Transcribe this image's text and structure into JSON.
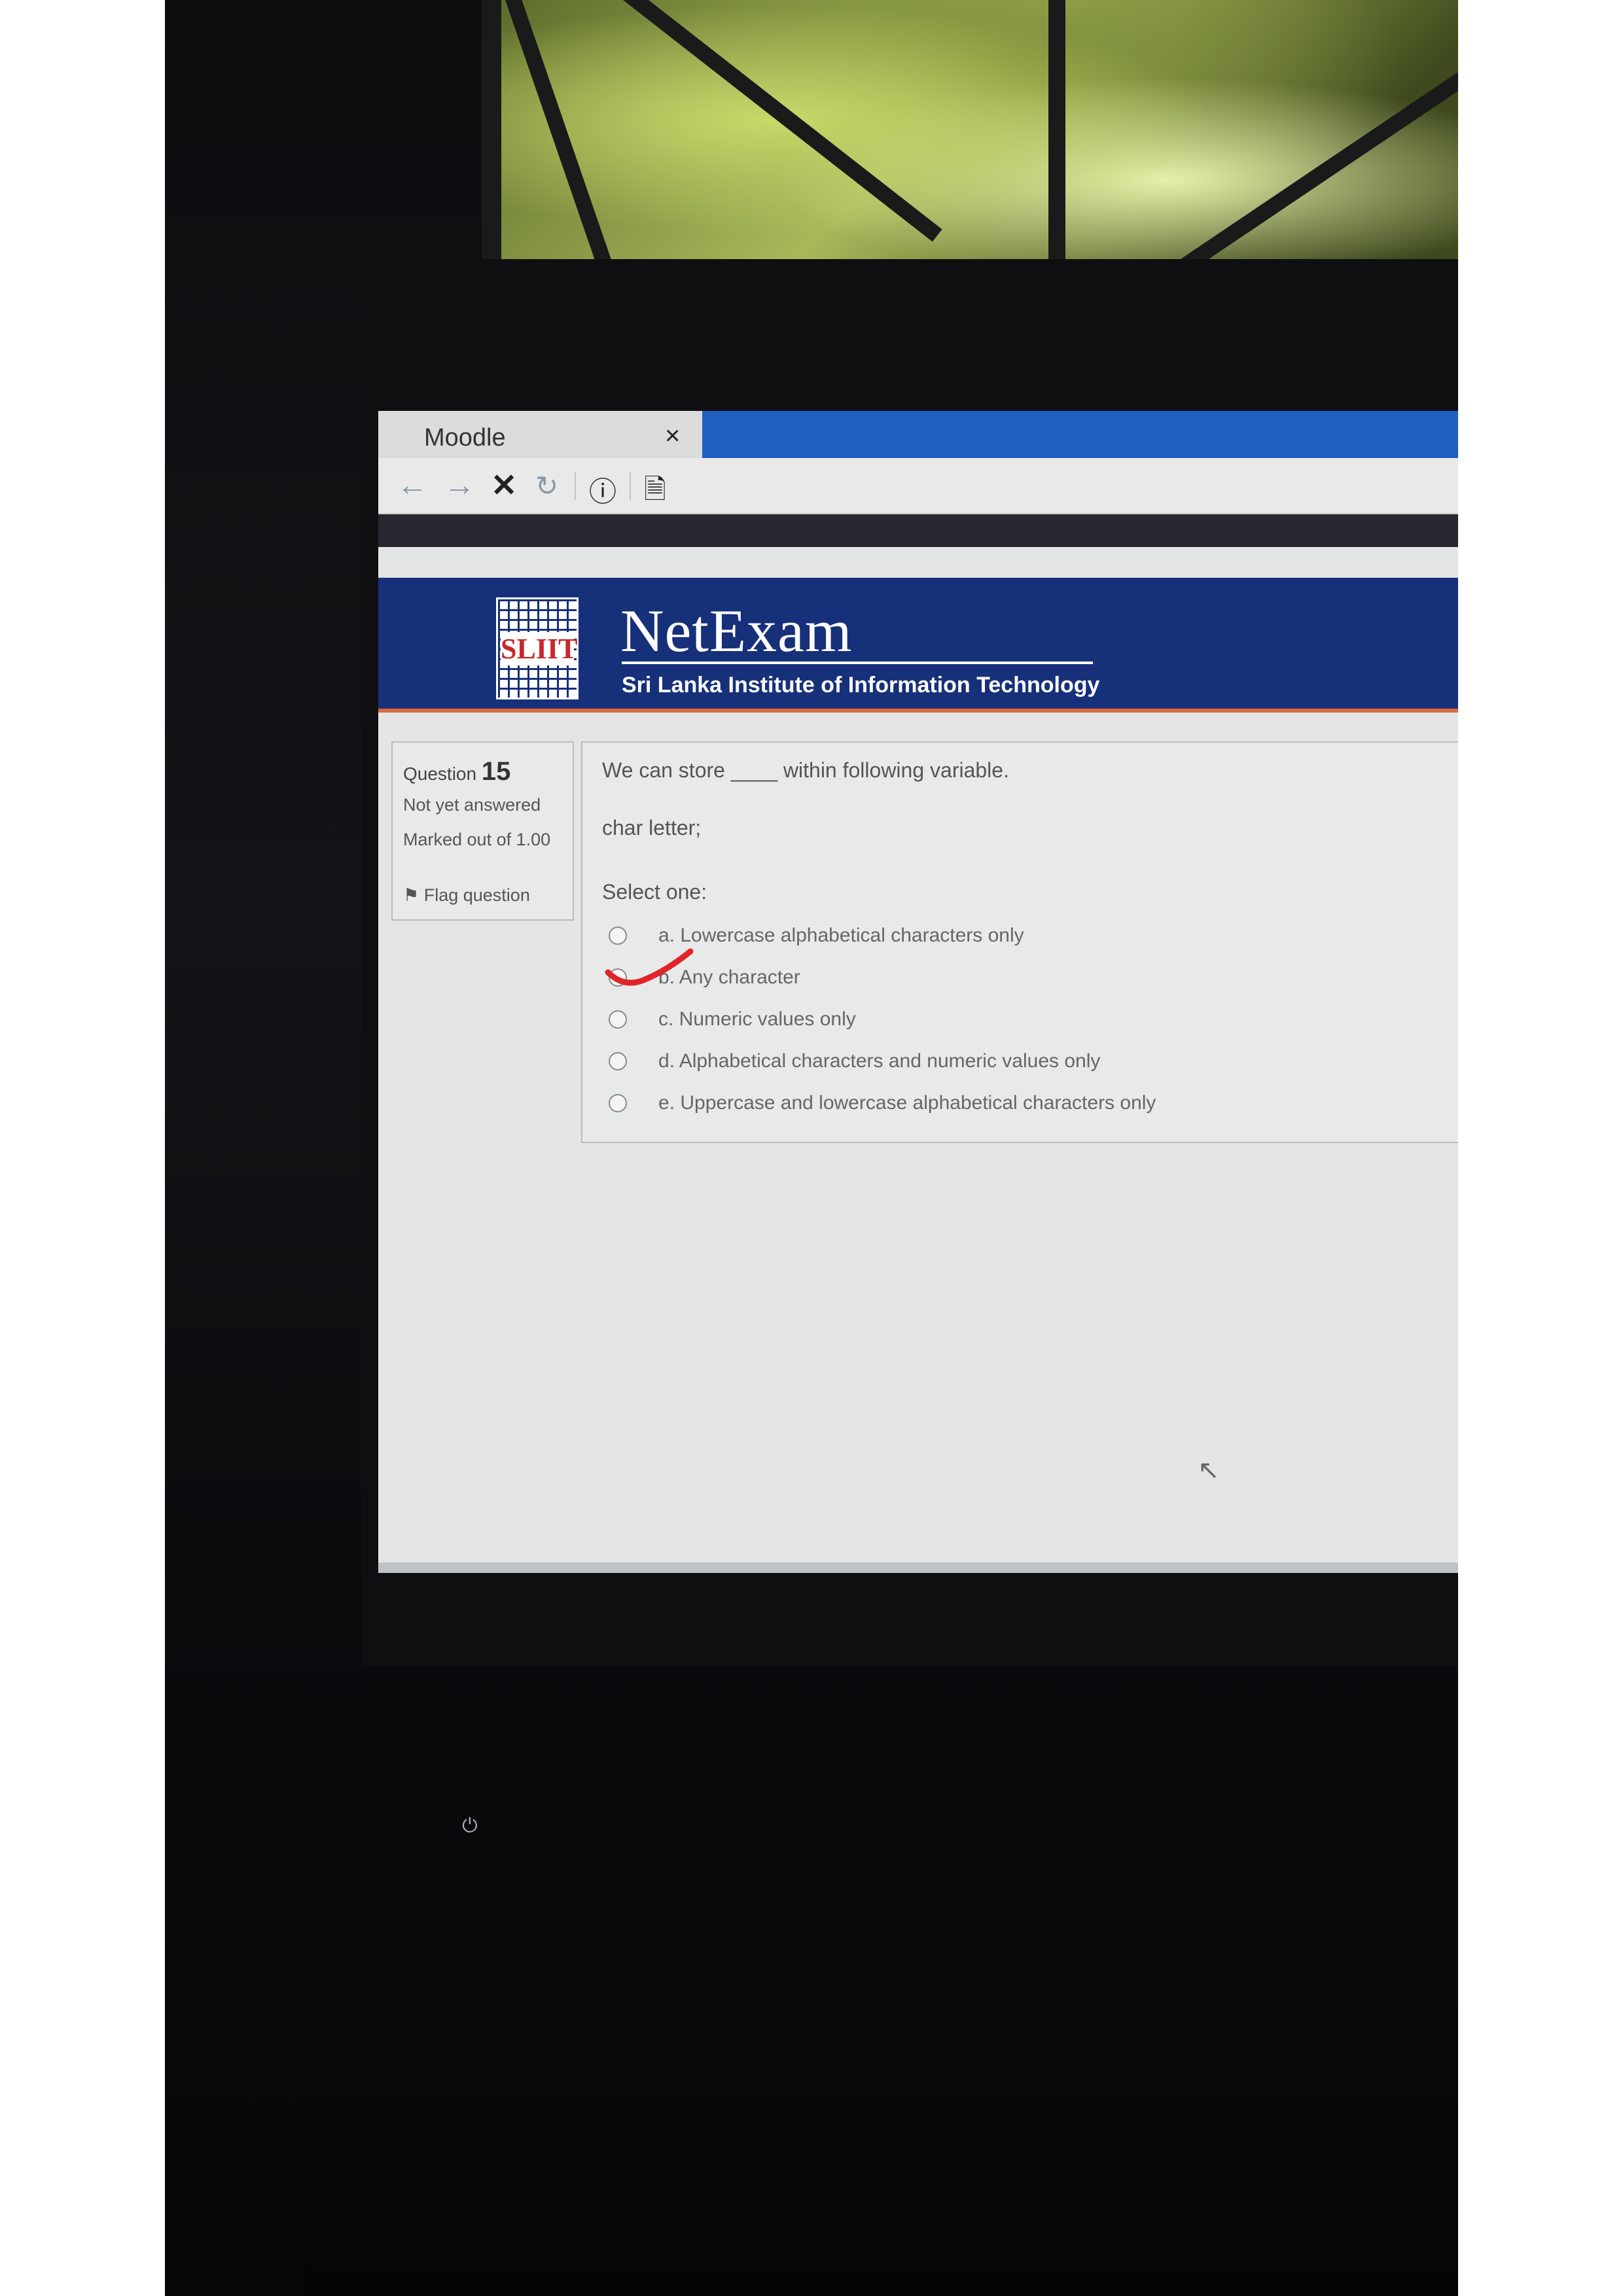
{
  "browser": {
    "tab_title": "Moodle",
    "close_glyph": "×",
    "toolbar_icons": [
      "back-arrow-icon",
      "forward-arrow-icon",
      "stop-icon",
      "reload-icon",
      "info-icon",
      "reader-icon"
    ]
  },
  "header": {
    "logo_text": "SLIIT",
    "brand_name": "NetExam",
    "subtitle": "Sri Lanka Institute of Information Technology"
  },
  "question_info": {
    "label": "Question",
    "number": "15",
    "state": "Not yet answered",
    "marked": "Marked out of 1.00",
    "flag": "Flag question"
  },
  "question": {
    "text": "We can store ____ within following variable.",
    "code": "char letter;",
    "select_label": "Select one:",
    "options": [
      "a. Lowercase alphabetical characters only",
      "b. Any character",
      "c. Numeric values only",
      "d. Alphabetical characters and numeric values only",
      "e. Uppercase and lowercase alphabetical characters only"
    ]
  },
  "colors": {
    "header_blue": "#17307a",
    "tab_blue": "#1f5fc2",
    "accent_orange": "#d96a3a",
    "check_red": "#e0242a"
  }
}
